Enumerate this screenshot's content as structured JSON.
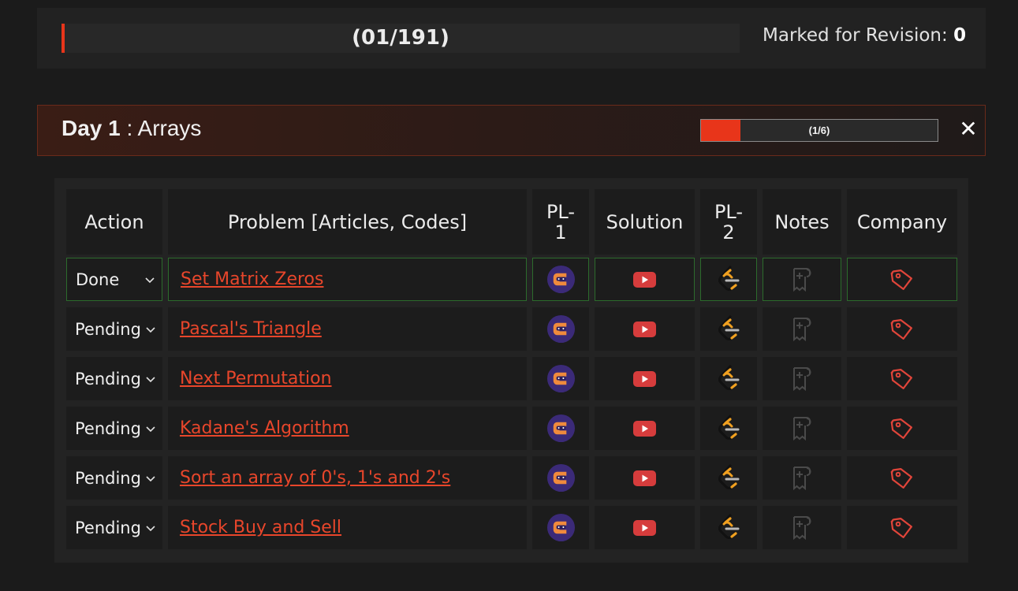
{
  "overall": {
    "progress_label": "(01/191)",
    "progress_fraction": 0.005,
    "revision_label": "Marked for Revision:",
    "revision_count": "0"
  },
  "day": {
    "day_label": "Day 1",
    "separator": " : ",
    "topic": "Arrays",
    "progress_label": "(1/6)",
    "progress_fraction": 0.1667,
    "close_symbol": "✕"
  },
  "table": {
    "headers": {
      "action": "Action",
      "problem": "Problem [Articles, Codes]",
      "pl1": "PL-1",
      "solution": "Solution",
      "pl2": "PL-2",
      "notes": "Notes",
      "company": "Company"
    },
    "rows": [
      {
        "status": "Done",
        "problem": "Set Matrix Zeros"
      },
      {
        "status": "Pending",
        "problem": "Pascal's Triangle"
      },
      {
        "status": "Pending",
        "problem": "Next Permutation"
      },
      {
        "status": "Pending",
        "problem": "Kadane's Algorithm"
      },
      {
        "status": "Pending",
        "problem": "Sort an array of 0's, 1's and 2's"
      },
      {
        "status": "Pending",
        "problem": "Stock Buy and Sell"
      }
    ]
  },
  "icons": {
    "pl1": "coding-ninjas-icon",
    "solution": "youtube-icon",
    "pl2": "leetcode-icon",
    "notes": "add-note-icon",
    "company": "tag-icon"
  },
  "colors": {
    "accent": "#e8351a",
    "link": "#e8462b",
    "done_border": "#2c6b2c",
    "youtube": "#d63c3c",
    "ninja_purple": "#3b2a78",
    "ninja_orange": "#f08a3c",
    "leetcode_orange": "#f0a020"
  }
}
